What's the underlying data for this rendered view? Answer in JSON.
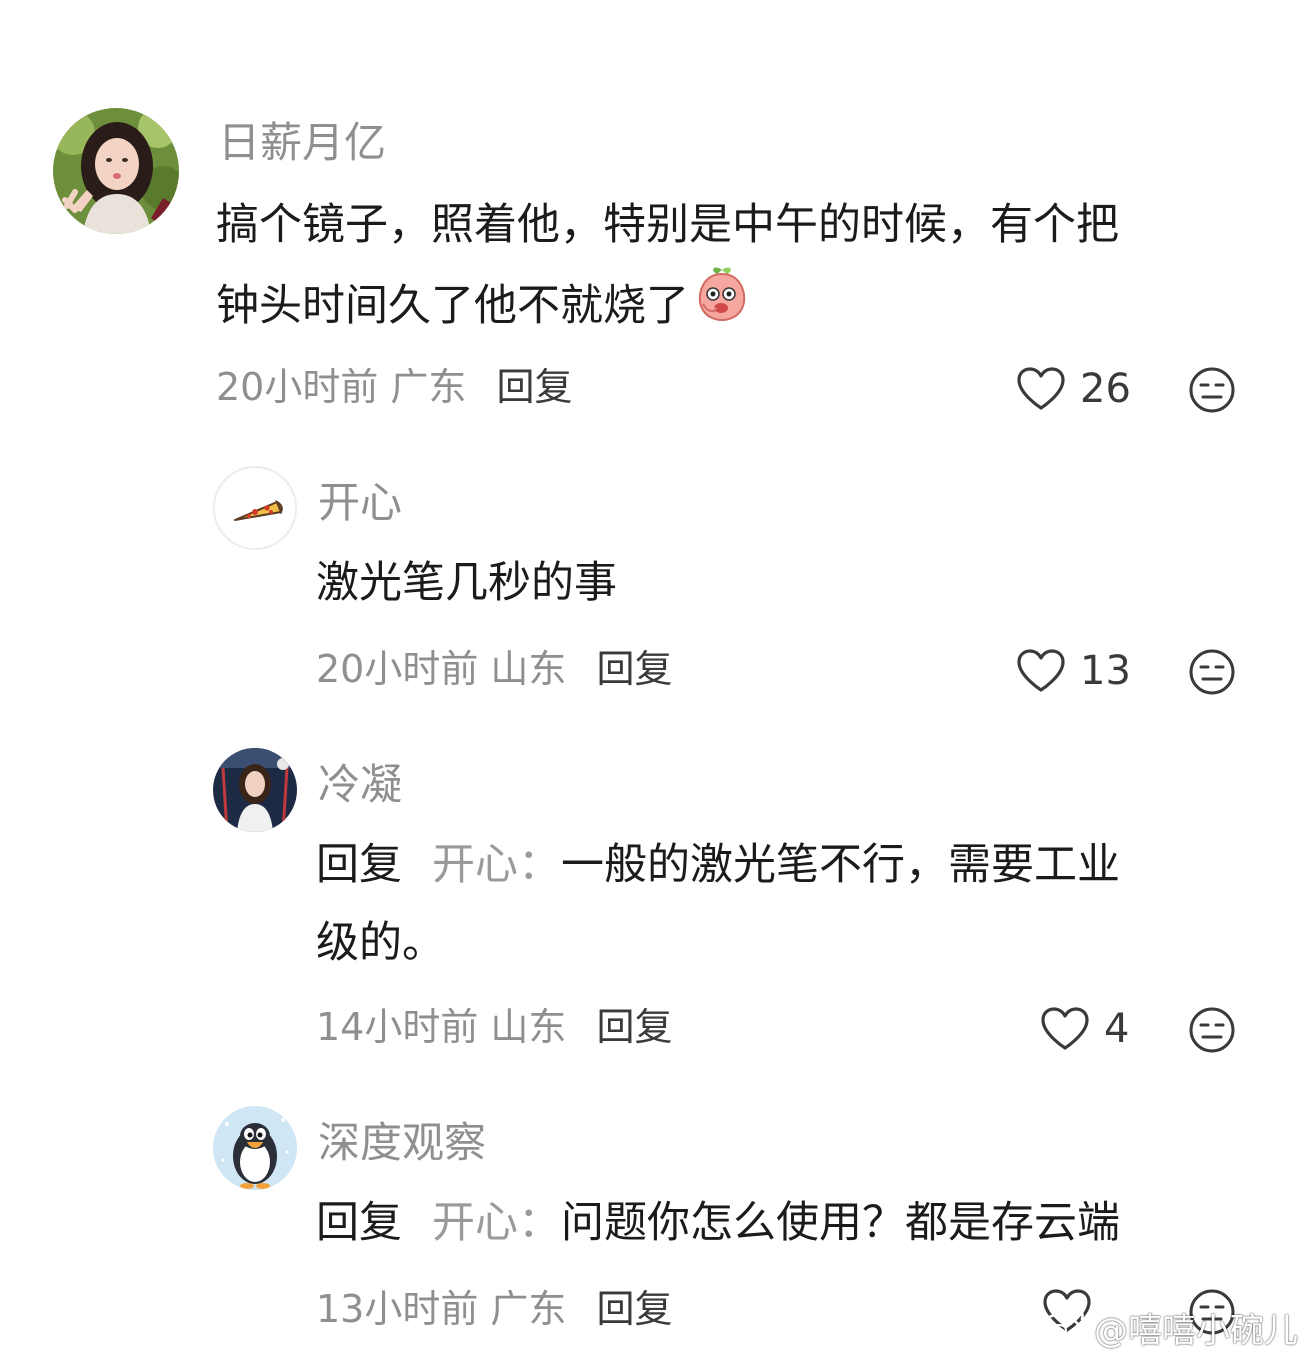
{
  "comments": [
    {
      "username": "日薪月亿",
      "content_line1": "搞个镜子，照着他，特别是中午的时候，有个把",
      "content_line2": "钟头时间久了他不就烧了",
      "time_location": "20小时前 广东",
      "reply_label": "回复",
      "likes": "26",
      "avatar_icon": "girl-portrait-avatar",
      "emoji_icon": "peach-emoji"
    },
    {
      "username": "开心",
      "content": "激光笔几秒的事",
      "time_location": "20小时前 山东",
      "reply_label": "回复",
      "likes": "13",
      "avatar_icon": "pizza-avatar"
    },
    {
      "username": "冷凝",
      "reply_prefix": "回复",
      "reply_target": "开心：",
      "content_line1": "一般的激光笔不行，需要工业",
      "content_line2": "级的。",
      "time_location": "14小时前 山东",
      "reply_label": "回复",
      "likes": "4",
      "avatar_icon": "woman-illustration-avatar"
    },
    {
      "username": "深度观察",
      "reply_prefix": "回复",
      "reply_target": "开心：",
      "content": "问题你怎么使用？都是存云端",
      "time_location": "13小时前 广东",
      "reply_label": "回复",
      "likes": "",
      "avatar_icon": "penguin-avatar"
    }
  ],
  "watermark": {
    "text": "@嘻嘻小碗儿",
    "icon": "weibo-logo-icon"
  },
  "colors": {
    "text_primary": "#1b1b1b",
    "text_secondary": "#8f8f8f",
    "background": "#ffffff"
  }
}
